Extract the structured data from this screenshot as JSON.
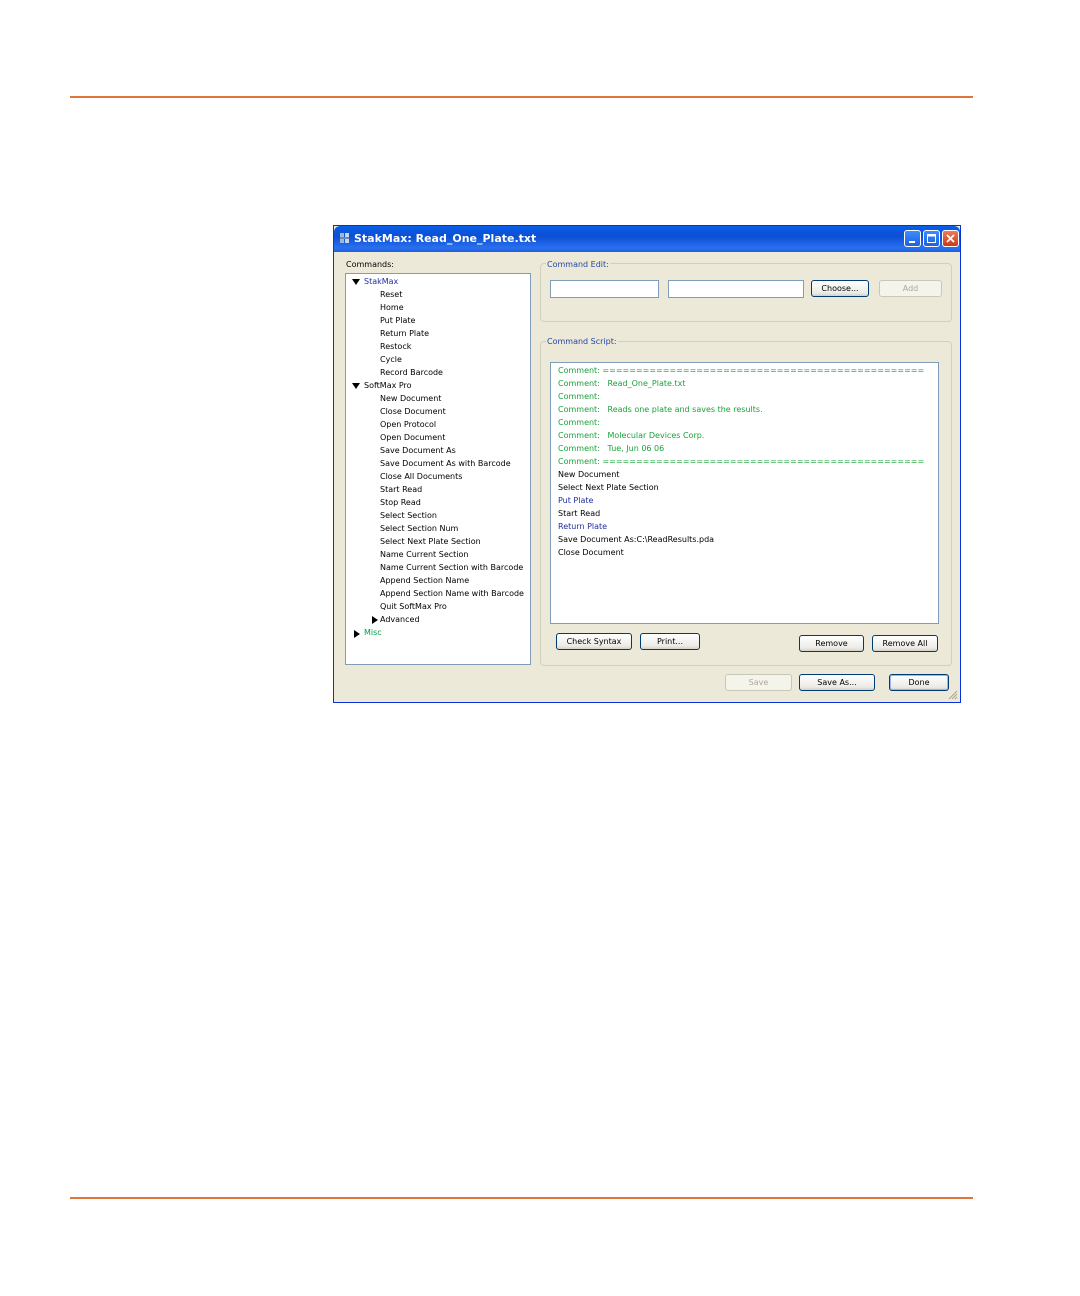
{
  "window": {
    "title": "StakMax: Read_One_Plate.txt",
    "accent_color": "#0b4fd3",
    "rule_color": "#e0743a"
  },
  "commands": {
    "label": "Commands:",
    "tree": [
      {
        "label": "StakMax",
        "expanded": true,
        "color": "#1e2da0",
        "items": [
          "Reset",
          "Home",
          "Put Plate",
          "Return Plate",
          "Restock",
          "Cycle",
          "Record Barcode"
        ]
      },
      {
        "label": "SoftMax Pro",
        "expanded": true,
        "color": "#000000",
        "items": [
          "New Document",
          "Close Document",
          "Open Protocol",
          "Open Document",
          "Save Document As",
          "Save Document As with Barcode",
          "Close All Documents",
          "Start Read",
          "Stop Read",
          "Select Section",
          "Select Section Num",
          "Select Next Plate Section",
          "Name Current Section",
          "Name Current Section with Barcode",
          "Append Section Name",
          "Append Section Name with Barcode",
          "Quit SoftMax Pro"
        ],
        "sub": {
          "label": "Advanced",
          "expanded": false
        }
      },
      {
        "label": "Misc",
        "expanded": false,
        "color": "#009a44",
        "items": []
      }
    ]
  },
  "command_edit": {
    "label": "Command Edit:",
    "field1_value": "",
    "field2_value": "",
    "choose_label": "Choose...",
    "add_label": "Add"
  },
  "command_script": {
    "label": "Command Script:",
    "lines": [
      {
        "text": "Comment: ================================================",
        "kind": "comment"
      },
      {
        "text": "Comment:   Read_One_Plate.txt",
        "kind": "comment"
      },
      {
        "text": "Comment:",
        "kind": "comment"
      },
      {
        "text": "Comment:   Reads one plate and saves the results.",
        "kind": "comment"
      },
      {
        "text": "Comment:",
        "kind": "comment"
      },
      {
        "text": "Comment:   Molecular Devices Corp.",
        "kind": "comment"
      },
      {
        "text": "Comment:   Tue, Jun 06 06",
        "kind": "comment"
      },
      {
        "text": "Comment: ================================================",
        "kind": "comment"
      },
      {
        "text": "New Document",
        "kind": "plain"
      },
      {
        "text": "Select Next Plate Section",
        "kind": "plain"
      },
      {
        "text": "Put Plate",
        "kind": "blue"
      },
      {
        "text": "Start Read",
        "kind": "plain"
      },
      {
        "text": "Return Plate",
        "kind": "blue"
      },
      {
        "text": "Save Document As:C:\\ReadResults.pda",
        "kind": "plain"
      },
      {
        "text": "Close Document",
        "kind": "plain"
      }
    ],
    "check_syntax_label": "Check Syntax",
    "print_label": "Print...",
    "remove_label": "Remove",
    "remove_all_label": "Remove All"
  },
  "footer": {
    "save_label": "Save",
    "save_as_label": "Save As...",
    "done_label": "Done"
  }
}
